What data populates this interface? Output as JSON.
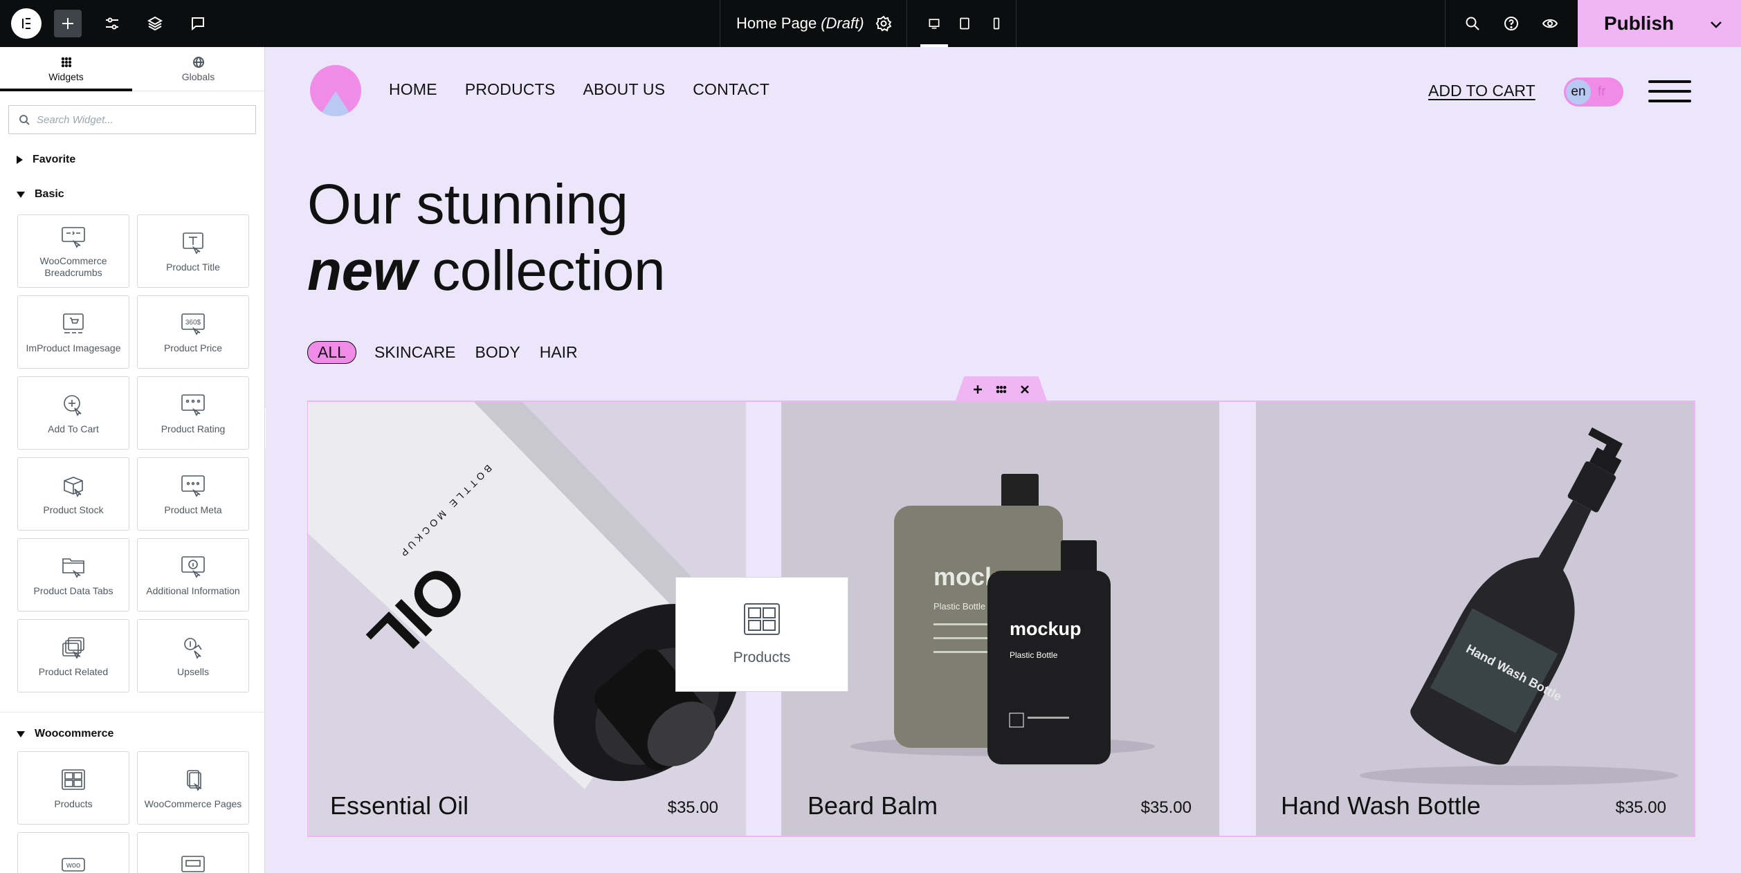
{
  "topbar": {
    "doc_title": "Home Page",
    "doc_status": "(Draft)",
    "publish_label": "Publish"
  },
  "panel": {
    "tabs": [
      {
        "label": "Widgets",
        "icon": "grid-icon"
      },
      {
        "label": "Globals",
        "icon": "globe-icon"
      }
    ],
    "search_placeholder": "Search Widget...",
    "sections": {
      "favorite": "Favorite",
      "basic": "Basic",
      "woocommerce": "Woocommerce"
    },
    "basic_widgets": [
      {
        "label": "WooCommerce Breadcrumbs",
        "icon": "breadcrumbs-icon"
      },
      {
        "label": "Product Title",
        "icon": "product-title-icon"
      },
      {
        "label": "ImProduct Imagesage",
        "icon": "product-image-icon"
      },
      {
        "label": "Product Price",
        "icon": "product-price-icon"
      },
      {
        "label": "Add To Cart",
        "icon": "add-to-cart-icon"
      },
      {
        "label": "Product Rating",
        "icon": "product-rating-icon"
      },
      {
        "label": "Product Stock",
        "icon": "product-stock-icon"
      },
      {
        "label": "Product Meta",
        "icon": "product-meta-icon"
      },
      {
        "label": "Product Data Tabs",
        "icon": "product-data-tabs-icon"
      },
      {
        "label": "Additional Information",
        "icon": "additional-information-icon"
      },
      {
        "label": "Product Related",
        "icon": "product-related-icon"
      },
      {
        "label": "Upsells",
        "icon": "upsells-icon"
      }
    ],
    "woo_widgets": [
      {
        "label": "Products",
        "icon": "products-icon"
      },
      {
        "label": "WooCommerce Pages",
        "icon": "woocommerce-pages-icon"
      }
    ],
    "price_icon_text": "360$",
    "woo_icon_text": "woo"
  },
  "site": {
    "nav": [
      "HOME",
      "PRODUCTS",
      "ABOUT US",
      "CONTACT"
    ],
    "add_to_cart": "ADD TO CART",
    "lang_active": "en",
    "lang_other": "fr",
    "hero_line1": "Our stunning",
    "hero_em": "new",
    "hero_rest": "collection",
    "filters": [
      "ALL",
      "SKINCARE",
      "BODY",
      "HAIR"
    ],
    "products": [
      {
        "name": "Essential Oil",
        "price": "$35.00",
        "label": "OIL",
        "sub": "BOTTLE MOCKUP"
      },
      {
        "name": "Beard Balm",
        "price": "$35.00",
        "label": "mockup",
        "sub": "Plastic Bottle"
      },
      {
        "name": "Hand Wash Bottle",
        "price": "$35.00",
        "label": "Hand Wash Bottle",
        "sub": ""
      }
    ],
    "drag_preview_label": "Products"
  },
  "colors": {
    "accent_pink": "#f08be8",
    "publish_bg": "#f0b5f3",
    "canvas_bg": "#ece6fb",
    "lang_blue": "#b8c9f3",
    "topbar_bg": "#0c0d0e"
  }
}
